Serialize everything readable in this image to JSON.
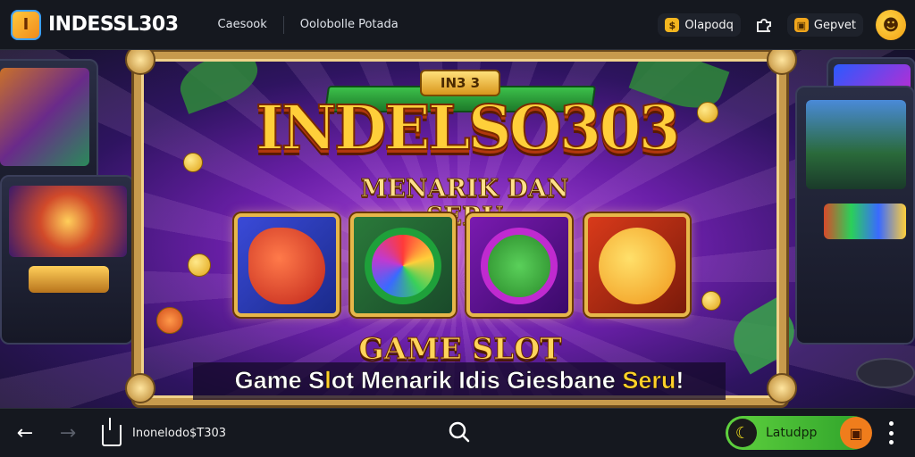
{
  "header": {
    "logo_mark": "I",
    "logo_text": "INDESSL303",
    "nav": [
      "Caesook",
      "Oolobolle Potada"
    ],
    "pill_1": {
      "icon": "coin-icon",
      "label": "Olapodq"
    },
    "pill_2": {
      "icon": "gift-icon",
      "label": "Gepvet"
    }
  },
  "hero": {
    "badge": "IN3 3",
    "title": "INDELSO303",
    "subtitle": "MENARIK DAN SERU",
    "slot_label": "GAME SLOT",
    "tagline": {
      "part_1": "Game S",
      "part_1_hl": "l",
      "part_2": "ot Menarik Idis Giesbane",
      "part_3_hl": "Seru",
      "part_4": "!"
    },
    "tiles": [
      {
        "icon": "dragon-icon",
        "color": "#d93a2a"
      },
      {
        "icon": "green-wheel-icon",
        "color": "#2ea83a"
      },
      {
        "icon": "letter-g-icon",
        "color": "#9a2bd0"
      },
      {
        "icon": "letter-s-icon",
        "color": "#ff9a14"
      }
    ]
  },
  "bottom_bar": {
    "url": "Inonelodo$T303",
    "promo_label": "Latudpp"
  },
  "colors": {
    "bar_bg": "#15181f",
    "frame_gold": "#c79a4c",
    "promo_green": "#2da12a",
    "accent_yellow": "#ffd02a"
  }
}
